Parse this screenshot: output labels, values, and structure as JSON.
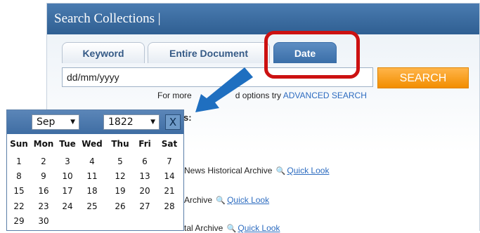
{
  "panel": {
    "title": "Search Collections |"
  },
  "tabs": {
    "keyword": "Keyword",
    "entire": "Entire Document",
    "date": "Date"
  },
  "search": {
    "value": "dd/mm/yyyy",
    "button": "SEARCH"
  },
  "more_options": {
    "prefix": "For more",
    "suffix": "d options try",
    "link": "ADVANCED SEARCH"
  },
  "heading_fragment": "s:",
  "results": [
    {
      "text": "News Historical Archive",
      "link": "Quick Look"
    },
    {
      "text": "Archive",
      "link": "Quick Look"
    },
    {
      "text": "tal Archive",
      "link": "Quick Look"
    }
  ],
  "calendar": {
    "month": "Sep",
    "year": "1822",
    "close": "X",
    "weekdays": [
      "Sun",
      "Mon",
      "Tue",
      "Wed",
      "Thu",
      "Fri",
      "Sat"
    ],
    "weeks": [
      [
        "1",
        "2",
        "3",
        "4",
        "5",
        "6",
        "7"
      ],
      [
        "8",
        "9",
        "10",
        "11",
        "12",
        "13",
        "14"
      ],
      [
        "15",
        "16",
        "17",
        "18",
        "19",
        "20",
        "21"
      ],
      [
        "22",
        "23",
        "24",
        "25",
        "26",
        "27",
        "28"
      ],
      [
        "29",
        "30",
        "",
        "",
        "",
        "",
        ""
      ]
    ]
  },
  "colors": {
    "header": "#3f6da3",
    "search_button": "#f28e00",
    "highlight": "#cc1111",
    "arrow": "#1f6fc0"
  }
}
